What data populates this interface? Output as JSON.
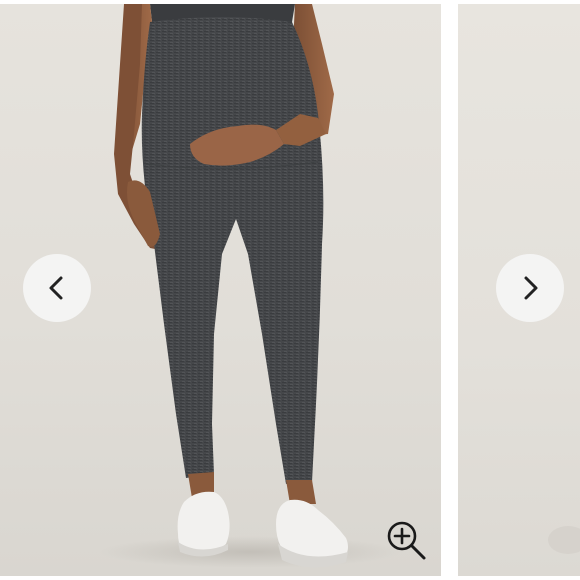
{
  "carousel": {
    "prev_button": {
      "label": "Previous image",
      "icon": "chevron-left-icon"
    },
    "next_button": {
      "label": "Next image",
      "icon": "chevron-right-icon"
    },
    "zoom_button": {
      "label": "Zoom image",
      "icon": "zoom-in-icon"
    },
    "colors": {
      "background": "#e3e0da",
      "leggings": "#46484a",
      "button_fill": "#f5f5f5",
      "icon_stroke": "#222222"
    }
  }
}
